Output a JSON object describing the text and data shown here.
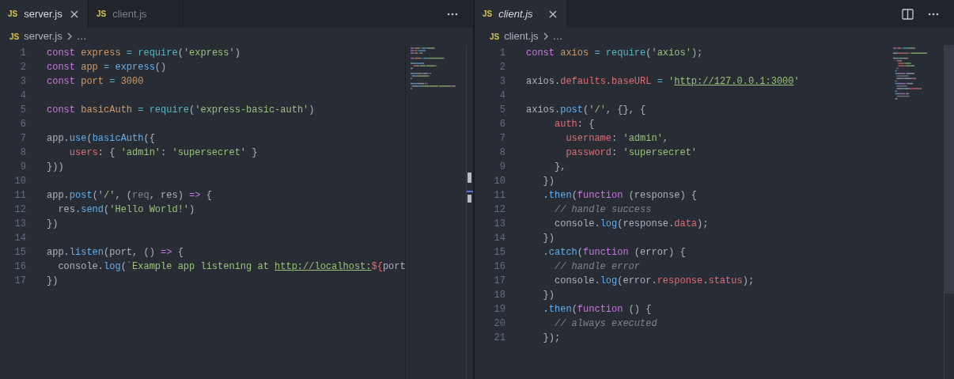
{
  "panes": [
    {
      "tabs": [
        {
          "badge": "JS",
          "label": "server.js",
          "selected": true,
          "preview": false
        },
        {
          "badge": "JS",
          "label": "client.js",
          "selected": false,
          "preview": false
        }
      ],
      "actions": [
        {
          "kind": "more"
        }
      ],
      "breadcrumb": {
        "badge": "JS",
        "file": "server.js",
        "rest": "…"
      },
      "lines": [
        {
          "number": "1",
          "tokens": [
            {
              "t": "const ",
              "kind": "kw"
            },
            {
              "t": "express",
              "kind": "var"
            },
            {
              "t": " = ",
              "kind": "op"
            },
            {
              "t": "require",
              "kind": "builtin"
            },
            {
              "t": "(",
              "kind": "plain"
            },
            {
              "t": "'express'",
              "kind": "str"
            },
            {
              "t": ")",
              "kind": "plain"
            }
          ]
        },
        {
          "number": "2",
          "tokens": [
            {
              "t": "const ",
              "kind": "kw"
            },
            {
              "t": "app",
              "kind": "var"
            },
            {
              "t": " = ",
              "kind": "op"
            },
            {
              "t": "express",
              "kind": "fn"
            },
            {
              "t": "()",
              "kind": "plain"
            }
          ]
        },
        {
          "number": "3",
          "tokens": [
            {
              "t": "const ",
              "kind": "kw"
            },
            {
              "t": "port",
              "kind": "var"
            },
            {
              "t": " = ",
              "kind": "op"
            },
            {
              "t": "3000",
              "kind": "var"
            }
          ]
        },
        {
          "number": "4"
        },
        {
          "number": "5",
          "tokens": [
            {
              "t": "const ",
              "kind": "kw"
            },
            {
              "t": "basicAuth",
              "kind": "var"
            },
            {
              "t": " = ",
              "kind": "op"
            },
            {
              "t": "require",
              "kind": "builtin"
            },
            {
              "t": "(",
              "kind": "plain"
            },
            {
              "t": "'express-basic-auth'",
              "kind": "str"
            },
            {
              "t": ")",
              "kind": "plain"
            }
          ]
        },
        {
          "number": "6"
        },
        {
          "number": "7",
          "tokens": [
            {
              "t": "app.",
              "kind": "plain"
            },
            {
              "t": "use",
              "kind": "fn"
            },
            {
              "t": "(",
              "kind": "plain"
            },
            {
              "t": "basicAuth",
              "kind": "fn"
            },
            {
              "t": "({",
              "kind": "plain"
            }
          ]
        },
        {
          "number": "8",
          "tokens": [
            {
              "t": "    users",
              "kind": "prop"
            },
            {
              "t": ": { ",
              "kind": "plain"
            },
            {
              "t": "'admin'",
              "kind": "str"
            },
            {
              "t": ": ",
              "kind": "plain"
            },
            {
              "t": "'supersecret'",
              "kind": "str"
            },
            {
              "t": " }",
              "kind": "plain"
            }
          ]
        },
        {
          "number": "9",
          "tokens": [
            {
              "t": "}))",
              "kind": "plain"
            }
          ]
        },
        {
          "number": "10"
        },
        {
          "number": "11",
          "tokens": [
            {
              "t": "app.",
              "kind": "plain"
            },
            {
              "t": "post",
              "kind": "fn"
            },
            {
              "t": "(",
              "kind": "plain"
            },
            {
              "t": "'/'",
              "kind": "str"
            },
            {
              "t": ", (",
              "kind": "plain"
            },
            {
              "t": "req",
              "kind": "dim"
            },
            {
              "t": ", res) ",
              "kind": "plain"
            },
            {
              "t": "=>",
              "kind": "kw"
            },
            {
              "t": " {",
              "kind": "plain"
            }
          ]
        },
        {
          "number": "12",
          "tokens": [
            {
              "t": "  res.",
              "kind": "plain"
            },
            {
              "t": "send",
              "kind": "fn"
            },
            {
              "t": "(",
              "kind": "plain"
            },
            {
              "t": "'Hello World!'",
              "kind": "str"
            },
            {
              "t": ")",
              "kind": "plain"
            }
          ]
        },
        {
          "number": "13",
          "tokens": [
            {
              "t": "})",
              "kind": "plain"
            }
          ]
        },
        {
          "number": "14"
        },
        {
          "number": "15",
          "tokens": [
            {
              "t": "app.",
              "kind": "plain"
            },
            {
              "t": "listen",
              "kind": "fn"
            },
            {
              "t": "(port, () ",
              "kind": "plain"
            },
            {
              "t": "=>",
              "kind": "kw"
            },
            {
              "t": " {",
              "kind": "plain"
            }
          ]
        },
        {
          "number": "16",
          "tokens": [
            {
              "t": "  console.",
              "kind": "plain"
            },
            {
              "t": "log",
              "kind": "fn"
            },
            {
              "t": "(",
              "kind": "plain"
            },
            {
              "t": "`Example app listening at ",
              "kind": "str"
            },
            {
              "t": "http://localhost:",
              "kind": "url"
            },
            {
              "t": "${",
              "kind": "interp"
            },
            {
              "t": "port",
              "kind": "plain"
            }
          ]
        },
        {
          "number": "17",
          "tokens": [
            {
              "t": "})",
              "kind": "plain"
            }
          ]
        }
      ]
    },
    {
      "tabs": [
        {
          "badge": "JS",
          "label": "client.js",
          "selected": true,
          "preview": true
        }
      ],
      "actions": [
        {
          "kind": "split"
        },
        {
          "kind": "more"
        }
      ],
      "breadcrumb": {
        "badge": "JS",
        "file": "client.js",
        "rest": "…"
      },
      "lines": [
        {
          "number": "1",
          "tokens": [
            {
              "t": "const ",
              "kind": "kw"
            },
            {
              "t": "axios",
              "kind": "var"
            },
            {
              "t": " = ",
              "kind": "op"
            },
            {
              "t": "require",
              "kind": "builtin"
            },
            {
              "t": "(",
              "kind": "plain"
            },
            {
              "t": "'axios'",
              "kind": "str"
            },
            {
              "t": ");",
              "kind": "plain"
            }
          ]
        },
        {
          "number": "2"
        },
        {
          "number": "3",
          "tokens": [
            {
              "t": "axios.",
              "kind": "plain"
            },
            {
              "t": "defaults",
              "kind": "prop"
            },
            {
              "t": ".",
              "kind": "plain"
            },
            {
              "t": "baseURL",
              "kind": "prop"
            },
            {
              "t": " = ",
              "kind": "op"
            },
            {
              "t": "'",
              "kind": "str"
            },
            {
              "t": "http://127.0.0.1:3000",
              "kind": "url"
            },
            {
              "t": "'",
              "kind": "str"
            }
          ]
        },
        {
          "number": "4"
        },
        {
          "number": "5",
          "tokens": [
            {
              "t": "axios.",
              "kind": "plain"
            },
            {
              "t": "post",
              "kind": "fn"
            },
            {
              "t": "(",
              "kind": "plain"
            },
            {
              "t": "'/'",
              "kind": "str"
            },
            {
              "t": ", {}, {",
              "kind": "plain"
            }
          ]
        },
        {
          "number": "6",
          "tokens": [
            {
              "t": "     auth",
              "kind": "prop"
            },
            {
              "t": ": {",
              "kind": "plain"
            }
          ]
        },
        {
          "number": "7",
          "tokens": [
            {
              "t": "       username",
              "kind": "prop"
            },
            {
              "t": ": ",
              "kind": "plain"
            },
            {
              "t": "'admin'",
              "kind": "str"
            },
            {
              "t": ",",
              "kind": "plain"
            }
          ]
        },
        {
          "number": "8",
          "tokens": [
            {
              "t": "       password",
              "kind": "prop"
            },
            {
              "t": ": ",
              "kind": "plain"
            },
            {
              "t": "'supersecret'",
              "kind": "str"
            }
          ]
        },
        {
          "number": "9",
          "tokens": [
            {
              "t": "     },",
              "kind": "plain"
            }
          ]
        },
        {
          "number": "10",
          "tokens": [
            {
              "t": "   })",
              "kind": "plain"
            }
          ]
        },
        {
          "number": "11",
          "tokens": [
            {
              "t": "   .",
              "kind": "plain"
            },
            {
              "t": "then",
              "kind": "fn"
            },
            {
              "t": "(",
              "kind": "plain"
            },
            {
              "t": "function",
              "kind": "kw"
            },
            {
              "t": " (response) {",
              "kind": "plain"
            }
          ]
        },
        {
          "number": "12",
          "tokens": [
            {
              "t": "     // handle success",
              "kind": "comment"
            }
          ]
        },
        {
          "number": "13",
          "tokens": [
            {
              "t": "     console.",
              "kind": "plain"
            },
            {
              "t": "log",
              "kind": "fn"
            },
            {
              "t": "(response.",
              "kind": "plain"
            },
            {
              "t": "data",
              "kind": "prop"
            },
            {
              "t": ");",
              "kind": "plain"
            }
          ]
        },
        {
          "number": "14",
          "tokens": [
            {
              "t": "   })",
              "kind": "plain"
            }
          ]
        },
        {
          "number": "15",
          "tokens": [
            {
              "t": "   .",
              "kind": "plain"
            },
            {
              "t": "catch",
              "kind": "fn"
            },
            {
              "t": "(",
              "kind": "plain"
            },
            {
              "t": "function",
              "kind": "kw"
            },
            {
              "t": " (error) {",
              "kind": "plain"
            }
          ]
        },
        {
          "number": "16",
          "tokens": [
            {
              "t": "     // handle error",
              "kind": "comment"
            }
          ]
        },
        {
          "number": "17",
          "tokens": [
            {
              "t": "     console.",
              "kind": "plain"
            },
            {
              "t": "log",
              "kind": "fn"
            },
            {
              "t": "(error.",
              "kind": "plain"
            },
            {
              "t": "response",
              "kind": "prop"
            },
            {
              "t": ".",
              "kind": "plain"
            },
            {
              "t": "status",
              "kind": "prop"
            },
            {
              "t": ");",
              "kind": "plain"
            }
          ]
        },
        {
          "number": "18",
          "tokens": [
            {
              "t": "   })",
              "kind": "plain"
            }
          ]
        },
        {
          "number": "19",
          "tokens": [
            {
              "t": "   .",
              "kind": "plain"
            },
            {
              "t": "then",
              "kind": "fn"
            },
            {
              "t": "(",
              "kind": "plain"
            },
            {
              "t": "function",
              "kind": "kw"
            },
            {
              "t": " () {",
              "kind": "plain"
            }
          ]
        },
        {
          "number": "20",
          "tokens": [
            {
              "t": "     // always executed",
              "kind": "comment"
            }
          ]
        },
        {
          "number": "21",
          "tokens": [
            {
              "t": "   });",
              "kind": "plain"
            }
          ]
        }
      ]
    }
  ]
}
